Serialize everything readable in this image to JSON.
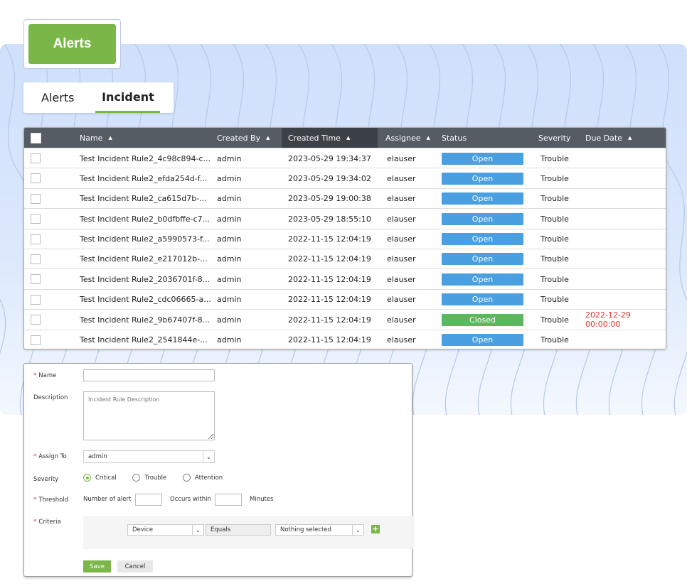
{
  "header": {
    "button_label": "Alerts"
  },
  "tabs": [
    {
      "label": "Alerts",
      "active": false
    },
    {
      "label": "Incident",
      "active": true
    }
  ],
  "table": {
    "columns": [
      {
        "label": "Name",
        "sort": "asc"
      },
      {
        "label": "Created By",
        "sort": "asc"
      },
      {
        "label": "Created Time",
        "sort": "asc",
        "active": true
      },
      {
        "label": "Assignee",
        "sort": "asc"
      },
      {
        "label": "Status"
      },
      {
        "label": "Severity"
      },
      {
        "label": "Due Date",
        "sort": "asc"
      }
    ],
    "rows": [
      {
        "name": "Test Incident Rule2_4c98c894-c...",
        "created_by": "admin",
        "created_time": "2023-05-29 19:34:37",
        "assignee": "elauser",
        "status": "Open",
        "severity": "Trouble",
        "due_date": ""
      },
      {
        "name": "Test Incident Rule2_efda254d-f...",
        "created_by": "admin",
        "created_time": "2023-05-29 19:34:02",
        "assignee": "elauser",
        "status": "Open",
        "severity": "Trouble",
        "due_date": ""
      },
      {
        "name": "Test Incident Rule2_ca615d7b-...",
        "created_by": "admin",
        "created_time": "2023-05-29 19:00:38",
        "assignee": "elauser",
        "status": "Open",
        "severity": "Trouble",
        "due_date": ""
      },
      {
        "name": "Test Incident Rule2_b0dfbffe-c7...",
        "created_by": "admin",
        "created_time": "2023-05-29 18:55:10",
        "assignee": "elauser",
        "status": "Open",
        "severity": "Trouble",
        "due_date": ""
      },
      {
        "name": "Test Incident Rule2_a5990573-f...",
        "created_by": "admin",
        "created_time": "2022-11-15 12:04:19",
        "assignee": "elauser",
        "status": "Open",
        "severity": "Trouble",
        "due_date": ""
      },
      {
        "name": "Test Incident Rule2_e217012b-...",
        "created_by": "admin",
        "created_time": "2022-11-15 12:04:19",
        "assignee": "elauser",
        "status": "Open",
        "severity": "Trouble",
        "due_date": ""
      },
      {
        "name": "Test Incident Rule2_2036701f-8...",
        "created_by": "admin",
        "created_time": "2022-11-15 12:04:19",
        "assignee": "elauser",
        "status": "Open",
        "severity": "Trouble",
        "due_date": ""
      },
      {
        "name": "Test Incident Rule2_cdc06665-a...",
        "created_by": "admin",
        "created_time": "2022-11-15 12:04:19",
        "assignee": "elauser",
        "status": "Open",
        "severity": "Trouble",
        "due_date": ""
      },
      {
        "name": "Test Incident Rule2_9b67407f-8...",
        "created_by": "admin",
        "created_time": "2022-11-15 12:04:19",
        "assignee": "elauser",
        "status": "Closed",
        "severity": "Trouble",
        "due_date": "2022-12-29 00:00:00"
      },
      {
        "name": "Test Incident Rule2_2541844e-...",
        "created_by": "admin",
        "created_time": "2022-11-15 12:04:19",
        "assignee": "elauser",
        "status": "Open",
        "severity": "Trouble",
        "due_date": ""
      }
    ]
  },
  "form": {
    "name_label": "Name",
    "name_value": "",
    "description_label": "Description",
    "description_placeholder": "Incident Rule Description",
    "assign_label": "Assign To",
    "assign_value": "admin",
    "severity_label": "Severity",
    "severity_options": [
      "Critical",
      "Trouble",
      "Attention"
    ],
    "severity_selected": "Critical",
    "threshold_label": "Threshold",
    "number_of_alert_label": "Number of alert",
    "occurs_within_label": "Occurs within",
    "minutes_label": "Minutes",
    "criteria_label": "Criteria",
    "criteria_field": "Device",
    "criteria_operator": "Equals",
    "criteria_value": "Nothing selected",
    "save_label": "Save",
    "cancel_label": "Cancel"
  },
  "colors": {
    "accent": "#7ab648",
    "open": "#4a9fe0",
    "closed": "#5cb85c",
    "overdue": "#d9342b",
    "header": "#555c63"
  }
}
